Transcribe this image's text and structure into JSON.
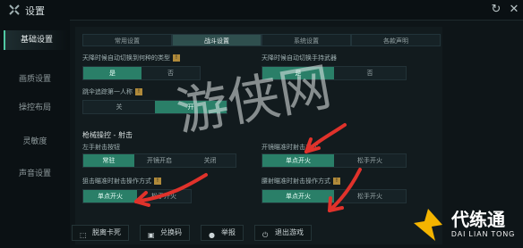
{
  "window": {
    "title": "设置"
  },
  "sidebar": {
    "items": [
      {
        "label": "基础设置",
        "active": true
      },
      {
        "label": "画质设置",
        "active": false
      },
      {
        "label": "操控布局",
        "active": false
      },
      {
        "label": "灵敏度",
        "active": false
      },
      {
        "label": "声音设置",
        "active": false
      }
    ]
  },
  "tabs": [
    {
      "label": "常用设置",
      "active": false
    },
    {
      "label": "战斗设置",
      "active": true
    },
    {
      "label": "系统设置",
      "active": false
    },
    {
      "label": "各款声明",
      "active": false
    }
  ],
  "settings": {
    "s1": {
      "label": "天降时候自动切换到何种的类型",
      "options": [
        "是",
        "否"
      ],
      "selected": 0
    },
    "s2": {
      "label": "天降时候自动切换手持武器",
      "options": [
        "是",
        "否"
      ],
      "selected": 0
    },
    "s3": {
      "label": "跳伞追踪第一人称",
      "options": [
        "关",
        "开"
      ],
      "selected": 1
    },
    "section_title": "枪械操控 - 射击",
    "s4": {
      "label": "左手射击按钮",
      "options": [
        "常驻",
        "开镜开启",
        "关闭"
      ],
      "selected": 0
    },
    "s5": {
      "label": "开镜瞄准时射击方式",
      "options": [
        "单点开火",
        "松手开火"
      ],
      "selected": 0
    },
    "s6": {
      "label": "狙击瞄准时射击操作方式",
      "options": [
        "单点开火",
        "松手开火"
      ],
      "selected": 0
    },
    "s7": {
      "label": "腰射瞄准时射击操作方式",
      "options": [
        "单点开火",
        "松手开火"
      ],
      "selected": 0
    }
  },
  "bottom_buttons": [
    {
      "label": "脱离卡死",
      "icon": "unstuck-icon"
    },
    {
      "label": "兑换码",
      "icon": "gift-icon"
    },
    {
      "label": "举报",
      "icon": "report-icon"
    },
    {
      "label": "退出游戏",
      "icon": "exit-icon"
    }
  ],
  "brand": {
    "name": "代练通",
    "sub": "DAI LIAN TONG"
  },
  "watermark": "游侠网",
  "colors": {
    "accent": "#2a7f68",
    "annotation_red": "#e0322b"
  }
}
